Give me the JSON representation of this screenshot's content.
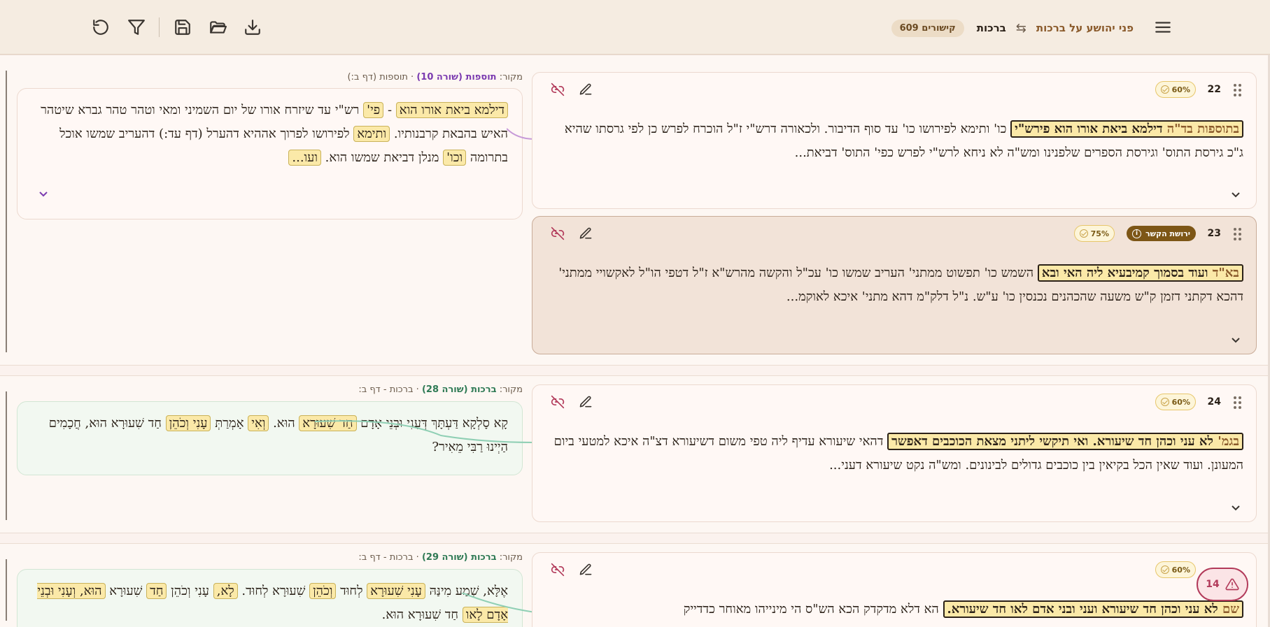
{
  "header": {
    "page_title": "פני יהושע על ברכות",
    "tractate": "ברכות",
    "connections_count": "609 קישורים",
    "icons": [
      "menu-icon",
      "swap-icon",
      "download-icon",
      "folder-open-icon",
      "save-icon",
      "filter-icon",
      "refresh-icon"
    ]
  },
  "rows": [
    {
      "card": {
        "number": "22",
        "confidence": "60%",
        "label": "בתוספות בד\"ה",
        "highlight": "דילמא ביאת אורו הוא פירש\"י",
        "text": "כו' ותימא לפירושו כו' עד סוף הדיבור. ולכאורה דרש\"י ז\"ל הוכרח לפרש כן לפי גרסתו שהיא ג\"כ גירסת התוס' וגירסת הספרים שלפנינו ומש\"ה לא ניחא לרש\"י לפרש כפי' התוס' דביאת..."
      },
      "source": {
        "prefix": "מקור:",
        "name": "תוספות (שורה 10)",
        "ref": "· תוספות (דף ב:)"
      },
      "excerpt": [
        {
          "t": "tag",
          "v": "דילמא ביאת אורו הוא"
        },
        {
          "t": "txt",
          "v": " - "
        },
        {
          "t": "tag",
          "v": "פי'"
        },
        {
          "t": "txt",
          "v": " רש\"י עד שיזרח אורו של יום השמיני ומאי וטהר טהר גברא שיטהר האיש בהבאת קרבנותיו. "
        },
        {
          "t": "tag",
          "v": "ותימא"
        },
        {
          "t": "txt",
          "v": " לפירושו לפרוך אההיא דהערל (דף עד:) דהעריב שמשו אוכל בתרומה "
        },
        {
          "t": "tag",
          "v": "וכו'"
        },
        {
          "t": "txt",
          "v": " מנלן דביאת שמשו הוא. "
        },
        {
          "t": "tag",
          "v": "ועו..."
        }
      ]
    },
    {
      "card": {
        "number": "23",
        "confidence": "75%",
        "inherited_badge": "ירושת הקשר",
        "label": "בא\"ד",
        "highlight": "ועוד בסמוך קמיבעיא ליה האי ובא",
        "text": "השמש כו' תפשוט ממתני' העריב שמשו כו' עכ\"ל והקשה מהרש\"א ז\"ל דטפי הו\"ל לאקשויי ממתני' דהכא דקתני דזמן ק\"ש משעה שהכהנים נכנסין כו' ע\"ש. נ\"ל דלק\"מ דהא מתני' איכא לאוקמ..."
      }
    },
    {
      "card": {
        "number": "24",
        "confidence": "60%",
        "label": "בגמ'",
        "highlight": "לא עני וכהן חד שיעורא. ואי תיקשי ליתני מצאת הכוכבים דאפשר",
        "text": "דהאי שיעורא עדיף ליה טפי משום דשיעורא דצ\"ה איכא למטעי ביום המעונן. ועוד שאין הכל בקיאין בין כוכבים גדולים לבינונים. ומש\"ה נקט שיעורא דעני..."
      },
      "source": {
        "prefix": "מקור:",
        "name": "ברכות (שורה 28)",
        "ref": "· ברכות - דף ב:"
      },
      "excerpt": [
        {
          "t": "txt",
          "v": "קָא סָלְקָא דַּעְתָּךְ דְּעָנִי וּבְנֵי אָדָם "
        },
        {
          "t": "tag",
          "v": "חַד שִׁעוּרָא"
        },
        {
          "t": "txt",
          "v": " הוּא. "
        },
        {
          "t": "tag",
          "v": "וְאִי"
        },
        {
          "t": "txt",
          "v": " אָמְרַתְּ "
        },
        {
          "t": "tag",
          "v": "עָנִי וְכֹהֵן"
        },
        {
          "t": "txt",
          "v": " חַד שִׁעוּרָא הוּא, חֲכָמִים הַיְינוּ רַבִּי מֵאִיר?"
        }
      ]
    },
    {
      "card": {
        "number": "",
        "confidence": "60%",
        "label": "שם",
        "highlight": "לא עני וכהן חד שיעורא ועני ובני אדם לאו חד שיעורא.",
        "text": "הא דלא מדקדק הכא הש\"ס הי מינייהו מאוחר כדדייק"
      },
      "source": {
        "prefix": "מקור:",
        "name": "ברכות (שורה 29)",
        "ref": "· ברכות - דף ב:"
      },
      "excerpt": [
        {
          "t": "txt",
          "v": "אֶלָּא, שְׁמַע מִינַּהּ "
        },
        {
          "t": "tag",
          "v": "עָנִי שִׁעוּרָא"
        },
        {
          "t": "txt",
          "v": " לְחוּד "
        },
        {
          "t": "tag",
          "v": "וְכֹהֵן"
        },
        {
          "t": "txt",
          "v": " שִׁעוּרָא לְחוּד. "
        },
        {
          "t": "tag",
          "v": "לָא,"
        },
        {
          "t": "txt",
          "v": " עָנִי וְכֹהֵן "
        },
        {
          "t": "tag",
          "v": "חַד"
        },
        {
          "t": "txt",
          "v": " שִׁעוּרָא "
        },
        {
          "t": "tag",
          "v": "הוּא, וְעָנִי וּבְנֵי אָדָם לָאו"
        },
        {
          "t": "txt",
          "v": " חַד שִׁעוּרָא הוּא."
        }
      ]
    }
  ],
  "warnings": {
    "count": "14"
  },
  "colors": {
    "accent": "#8a5a2b",
    "purple": "#7b3bb0",
    "green": "#2f7a55",
    "danger": "#b23a5a",
    "highlight": "#fbe9a8"
  }
}
